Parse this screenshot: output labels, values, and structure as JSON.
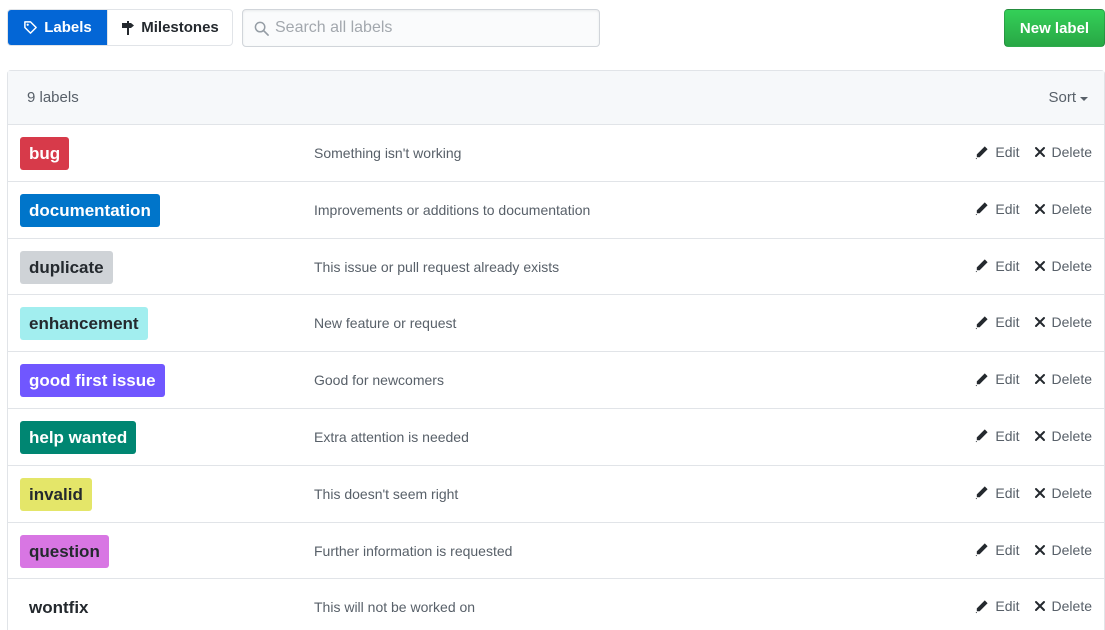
{
  "nav": {
    "labels_tab": "Labels",
    "milestones_tab": "Milestones"
  },
  "search": {
    "placeholder": "Search all labels",
    "value": ""
  },
  "new_label_button": "New label",
  "list": {
    "count_text": "9 labels",
    "sort_label": "Sort",
    "edit_label": "Edit",
    "delete_label": "Delete",
    "labels": [
      {
        "name": "bug",
        "description": "Something isn't working",
        "color": "#d73a4a",
        "text_color": "#ffffff"
      },
      {
        "name": "documentation",
        "description": "Improvements or additions to documentation",
        "color": "#0075ca",
        "text_color": "#ffffff"
      },
      {
        "name": "duplicate",
        "description": "This issue or pull request already exists",
        "color": "#cfd3d7",
        "text_color": "#24292e"
      },
      {
        "name": "enhancement",
        "description": "New feature or request",
        "color": "#a2eeef",
        "text_color": "#24292e"
      },
      {
        "name": "good first issue",
        "description": "Good for newcomers",
        "color": "#7057ff",
        "text_color": "#ffffff"
      },
      {
        "name": "help wanted",
        "description": "Extra attention is needed",
        "color": "#008672",
        "text_color": "#ffffff"
      },
      {
        "name": "invalid",
        "description": "This doesn't seem right",
        "color": "#e4e669",
        "text_color": "#24292e"
      },
      {
        "name": "question",
        "description": "Further information is requested",
        "color": "#d876e3",
        "text_color": "#24292e"
      },
      {
        "name": "wontfix",
        "description": "This will not be worked on",
        "color": "#ffffff",
        "text_color": "#24292e"
      }
    ]
  },
  "colors": {
    "accent": "#0366d6",
    "primary_button": "#2ea44f",
    "border": "#e1e4e8",
    "muted_text": "#586069"
  }
}
